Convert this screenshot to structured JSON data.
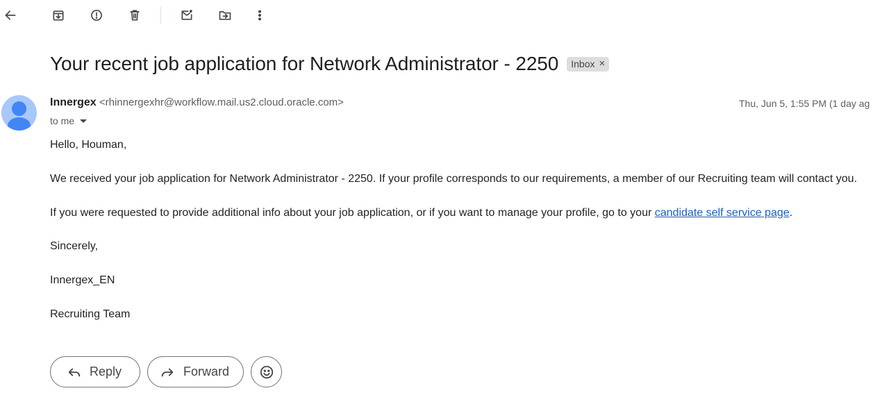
{
  "toolbar": {
    "back_icon": "arrow-left-icon",
    "archive_icon": "archive-icon",
    "spam_icon": "report-spam-icon",
    "delete_icon": "trash-icon",
    "mark_unread_icon": "mark-unread-icon",
    "move_icon": "move-to-icon",
    "more_icon": "more-vertical-icon"
  },
  "email": {
    "subject": "Your recent job application for Network Administrator - 2250",
    "label": "Inbox",
    "label_remove": "×",
    "sender_name": "Innergex",
    "sender_email": "<rhinnergexhr@workflow.mail.us2.cloud.oracle.com>",
    "date": "Thu, Jun 5, 1:55 PM (1 day ag",
    "to": "to me",
    "body": {
      "greeting": "Hello, Houman,",
      "paragraph1": "We received your job application for Network Administrator - 2250. If your profile corresponds to our requirements, a member of our Recruiting team will contact you.",
      "paragraph2_before": "If you were requested to provide additional info about your job application, or if you want to manage your profile, go to your ",
      "paragraph2_link": "candidate self service page",
      "paragraph2_after": ".",
      "closing": "Sincerely,",
      "signature1": "Innergex_EN",
      "signature2": "Recruiting Team"
    }
  },
  "actions": {
    "reply_label": "Reply",
    "forward_label": "Forward",
    "emoji_icon": "smiley-icon"
  },
  "colors": {
    "link": "#1a5ebd",
    "avatar_bg": "#a8c7fa",
    "avatar_fg": "#4285f4",
    "label_bg": "#dddddd"
  }
}
